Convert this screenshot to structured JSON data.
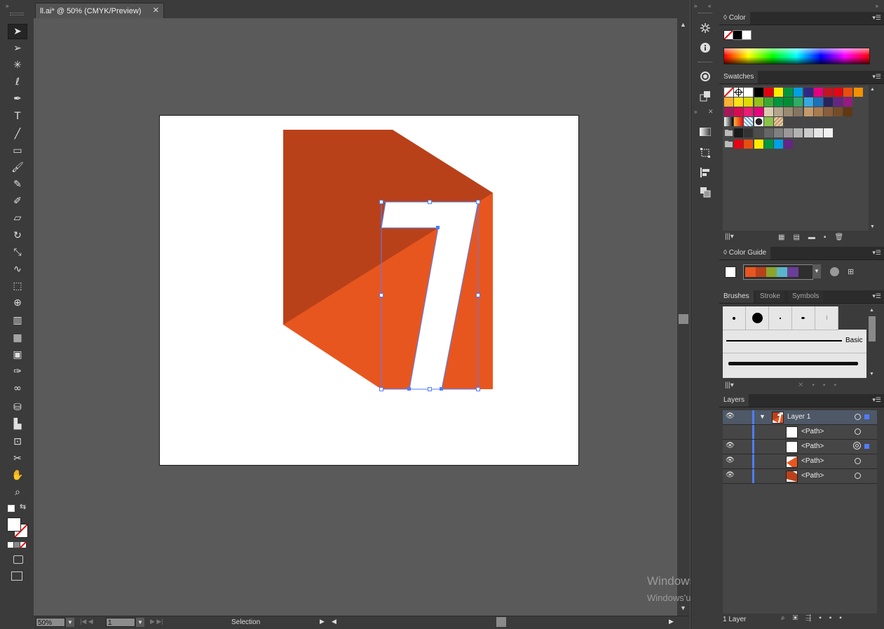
{
  "document": {
    "tab_title": "ll.ai* @ 50% (CMYK/Preview)",
    "zoom": "50%",
    "artboard_number": "1",
    "status_tool": "Selection"
  },
  "toolbar": {
    "tools": [
      "selection-tool",
      "direct-selection-tool",
      "magic-wand-tool",
      "lasso-tool",
      "pen-tool",
      "type-tool",
      "line-tool",
      "rectangle-tool",
      "paintbrush-tool",
      "pencil-tool",
      "blob-brush-tool",
      "eraser-tool",
      "rotate-tool",
      "scale-tool",
      "warp-tool",
      "free-transform-tool",
      "shape-builder-tool",
      "perspective-grid-tool",
      "mesh-tool",
      "gradient-tool",
      "eyedropper-tool",
      "blend-tool",
      "symbol-sprayer-tool",
      "column-graph-tool",
      "artboard-tool",
      "slice-tool",
      "hand-tool",
      "zoom-tool"
    ]
  },
  "panels": {
    "color": {
      "tab": "Color"
    },
    "swatches": {
      "tab": "Swatches"
    },
    "color_guide": {
      "tab": "Color Guide"
    },
    "brushes": {
      "tabs": [
        "Brushes",
        "Stroke",
        "Symbols"
      ],
      "basic_label": "Basic"
    },
    "layers": {
      "tab": "Layers",
      "layer_name": "Layer 1",
      "items": [
        "<Path>",
        "<Path>",
        "<Path>",
        "<Path>"
      ],
      "count_label": "1 Layer"
    }
  },
  "watermark": {
    "title": "Windows'u Etkinleştir",
    "subtitle": "Windows'u etkinleştirmek için Ayarlar'a gidin."
  },
  "colors": {
    "dark_orange": "#b9411a",
    "orange": "#e8561f",
    "selection": "#4f7dff"
  }
}
